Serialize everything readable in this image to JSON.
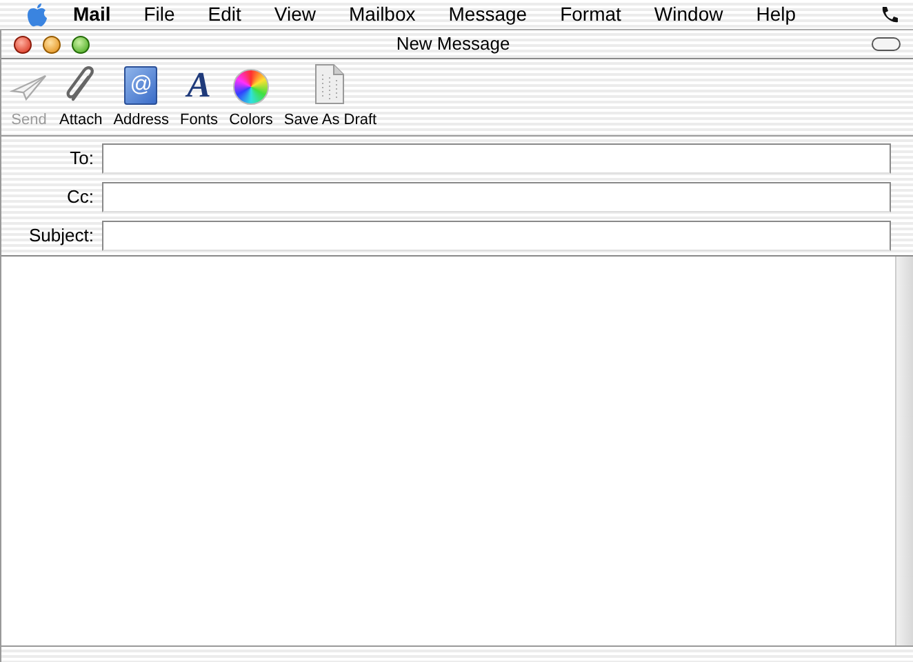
{
  "menu_bar": {
    "menus": [
      {
        "label": "Mail",
        "kind": "app"
      },
      {
        "label": "File",
        "kind": "menu"
      },
      {
        "label": "Edit",
        "kind": "menu"
      },
      {
        "label": "View",
        "kind": "menu"
      },
      {
        "label": "Mailbox",
        "kind": "menu"
      },
      {
        "label": "Message",
        "kind": "menu"
      },
      {
        "label": "Format",
        "kind": "menu"
      },
      {
        "label": "Window",
        "kind": "menu"
      },
      {
        "label": "Help",
        "kind": "menu"
      }
    ]
  },
  "window": {
    "title": "New Message"
  },
  "toolbar": [
    {
      "label": "Send",
      "kind": "send",
      "disabled": true
    },
    {
      "label": "Attach",
      "kind": "attach",
      "disabled": false
    },
    {
      "label": "Address",
      "kind": "address",
      "disabled": false,
      "glyph": "@"
    },
    {
      "label": "Fonts",
      "kind": "fonts",
      "disabled": false,
      "glyph": "A"
    },
    {
      "label": "Colors",
      "kind": "colors",
      "disabled": false
    },
    {
      "label": "Save As Draft",
      "kind": "draft",
      "disabled": false
    }
  ],
  "fields": [
    {
      "label": "To:"
    },
    {
      "label": "Cc:"
    },
    {
      "label": "Subject:"
    }
  ]
}
